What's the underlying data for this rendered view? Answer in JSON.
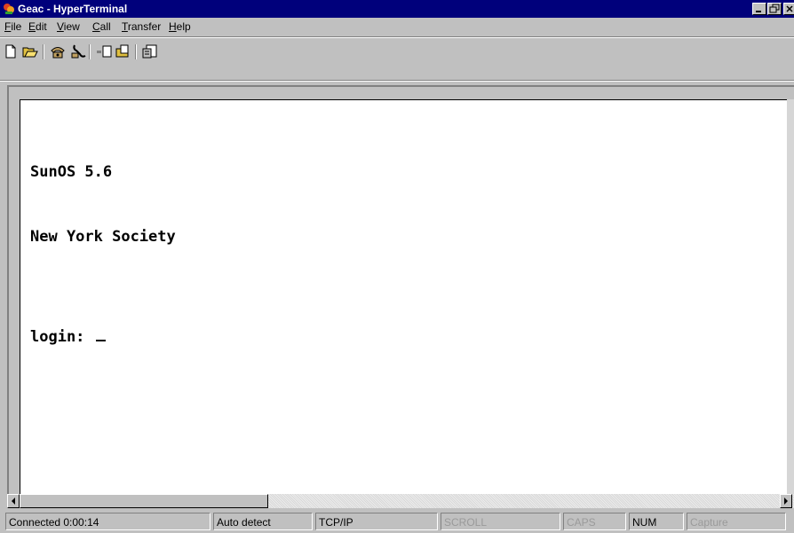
{
  "window": {
    "title": "Geac - HyperTerminal",
    "app_icon": "hyperterminal-app-icon",
    "controls": [
      "minimize-icon",
      "maximize-icon",
      "close-icon"
    ]
  },
  "menu": {
    "items": [
      {
        "label": "File",
        "icon": null
      },
      {
        "label": "Edit",
        "icon": null
      },
      {
        "label": "View",
        "icon": null
      },
      {
        "label": "Call",
        "icon": null
      },
      {
        "label": "Transfer",
        "icon": null
      },
      {
        "label": "Help",
        "icon": null
      }
    ]
  },
  "toolbar": {
    "buttons": [
      "new-icon",
      "open-icon",
      "connect-icon",
      "disconnect-icon",
      "send-icon",
      "receive-icon",
      "properties-icon"
    ]
  },
  "terminal": {
    "lines": [
      "SunOS 5.6",
      "New York Society",
      "login: "
    ]
  },
  "status": {
    "connected": "Connected 0:00:14",
    "detect": "Auto detect",
    "protocol": "TCP/IP",
    "scroll": "SCROLL",
    "caps": "CAPS",
    "num": "NUM",
    "capture": "Capture"
  },
  "colors": {
    "titlebar": "#00007b",
    "face": "#c0c0c0",
    "terminal_bg": "#ffffff"
  }
}
